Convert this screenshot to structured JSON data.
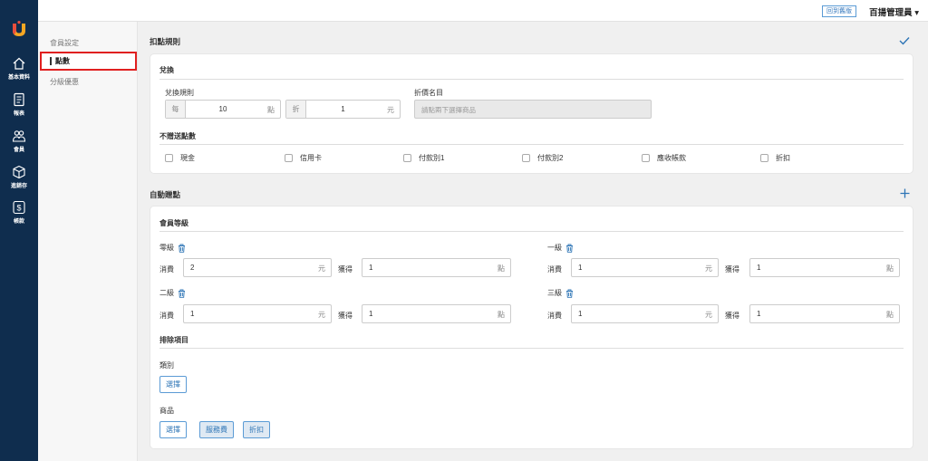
{
  "rail": {
    "items": [
      {
        "label": "基本資料",
        "icon": "home-icon"
      },
      {
        "label": "報表",
        "icon": "report-icon"
      },
      {
        "label": "會員",
        "icon": "members-icon"
      },
      {
        "label": "進銷存",
        "icon": "inventory-icon"
      },
      {
        "label": "帳款",
        "icon": "dollar-icon"
      }
    ]
  },
  "topbar": {
    "back_label": "回到舊版",
    "user_label": "百揚管理員 ▾"
  },
  "subnav": {
    "items": [
      "會員設定",
      "點數",
      "分級優惠"
    ]
  },
  "redeem_rules": {
    "title": "扣點規則",
    "exchange_heading": "兌換",
    "exchange_rule_label": "兌換規則",
    "per_prefix": "每",
    "points_value": "10",
    "points_unit": "點",
    "discount_prefix": "折",
    "dollar_value": "1",
    "dollar_unit": "元",
    "discount_name_label": "折價名目",
    "discount_name_placeholder": "請點兩下選擇商品",
    "no_points_heading": "不贈送點數",
    "payment_options": [
      "現金",
      "信用卡",
      "付款別1",
      "付款別2",
      "應收帳款",
      "折扣"
    ]
  },
  "auto_points": {
    "title": "自動贈點",
    "level_heading": "會員等級",
    "spend_label": "消費",
    "earn_label": "獲得",
    "dollar_unit": "元",
    "points_unit": "點",
    "tiers": [
      {
        "name": "零級",
        "spend": "2",
        "earn": "1"
      },
      {
        "name": "一級",
        "spend": "1",
        "earn": "1"
      },
      {
        "name": "二級",
        "spend": "1",
        "earn": "1"
      },
      {
        "name": "三級",
        "spend": "1",
        "earn": "1"
      }
    ],
    "exclude_heading": "排除項目",
    "category_label": "類別",
    "category_button": "選擇",
    "product_label": "商品",
    "product_buttons": [
      "選擇",
      "服務費",
      "折扣"
    ]
  },
  "colors": {
    "rail_bg": "#0f2d4e",
    "accent": "#2e75b6",
    "highlight": "#e02020"
  }
}
